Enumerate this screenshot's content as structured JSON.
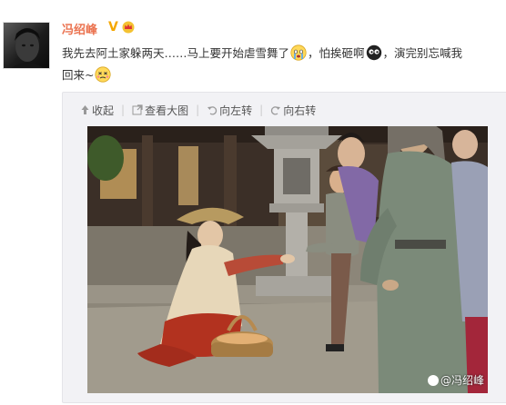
{
  "user": {
    "name": "冯绍峰",
    "badge": "V"
  },
  "post": {
    "line1_a": "我先去阿土家躲两天……马上要开始虐雪舞了",
    "line1_b": "，怕挨砸啊",
    "line1_c": "，演完别忘喊我",
    "line2": "回来~"
  },
  "toolbar": {
    "collapse": "收起",
    "view_large": "查看大图",
    "rotate_left": "向左转",
    "rotate_right": "向右转"
  },
  "photo": {
    "watermark": "冯绍峰"
  },
  "colors": {
    "username": "#eb7350",
    "card_bg": "#f2f2f5"
  }
}
